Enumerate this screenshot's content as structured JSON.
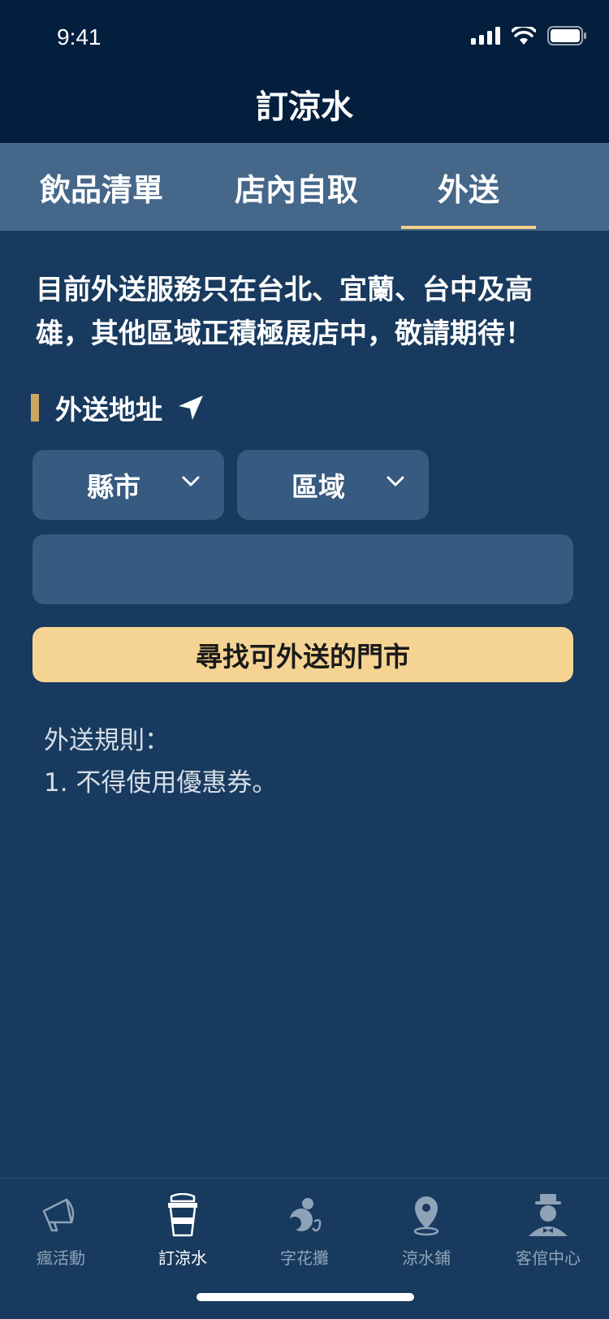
{
  "status_bar": {
    "time": "9:41"
  },
  "nav": {
    "title": "訂涼水"
  },
  "tabs": [
    {
      "label": "飲品清單",
      "active": false
    },
    {
      "label": "店內自取",
      "active": false
    },
    {
      "label": "外送",
      "active": true
    }
  ],
  "notice": "目前外送服務只在台北、宜蘭、台中及高雄，其他區域正積極展店中，敬請期待！",
  "address_section": {
    "title": "外送地址",
    "icon": "location-arrow-icon",
    "city_select": {
      "label": "縣市"
    },
    "district_select": {
      "label": "區域"
    },
    "address_input": {
      "value": "",
      "placeholder": ""
    },
    "find_button": "尋找可外送的門市"
  },
  "rules": {
    "title": "外送規則：",
    "items": [
      "1. 不得使用優惠券。"
    ]
  },
  "tabbar": [
    {
      "label": "瘋活動",
      "icon": "megaphone-icon",
      "active": false
    },
    {
      "label": "訂涼水",
      "icon": "drink-cup-icon",
      "active": true
    },
    {
      "label": "字花攤",
      "icon": "gourd-icon",
      "active": false
    },
    {
      "label": "涼水鋪",
      "icon": "map-pin-icon",
      "active": false
    },
    {
      "label": "客倌中心",
      "icon": "user-hat-icon",
      "active": false
    }
  ],
  "colors": {
    "header_bg": "#041f3d",
    "tab_bg": "#456789",
    "page_bg": "#183a5e",
    "accent": "#f5d493",
    "section_bar": "#caa75e"
  }
}
